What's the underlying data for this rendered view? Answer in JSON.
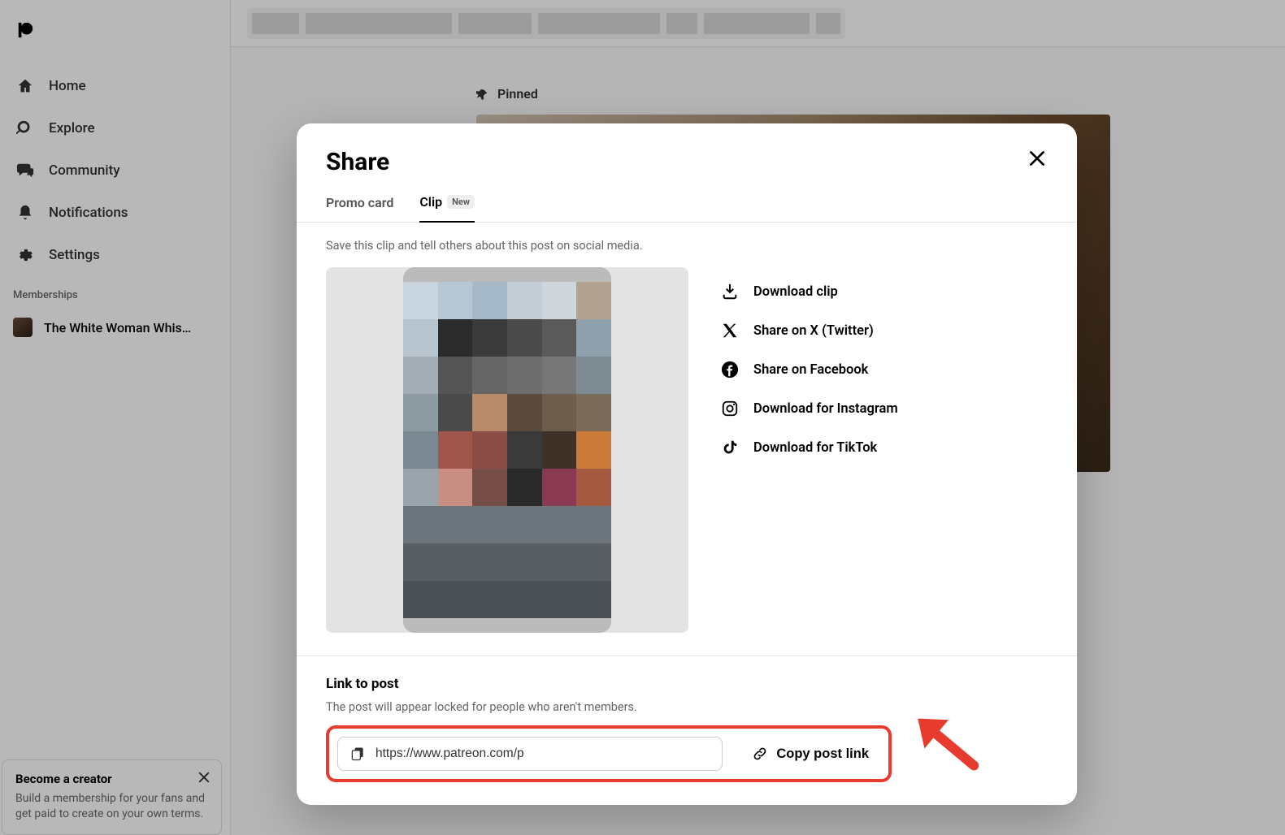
{
  "sidebar": {
    "items": [
      {
        "label": "Home",
        "icon": "home-icon"
      },
      {
        "label": "Explore",
        "icon": "search-icon"
      },
      {
        "label": "Community",
        "icon": "chat-icon"
      },
      {
        "label": "Notifications",
        "icon": "bell-icon"
      },
      {
        "label": "Settings",
        "icon": "gear-icon"
      }
    ],
    "memberships_label": "Memberships",
    "memberships": [
      {
        "label": "The White Woman Whis…"
      }
    ],
    "creator_card": {
      "title": "Become a creator",
      "desc": "Build a membership for your fans and get paid to create on your own terms."
    }
  },
  "content": {
    "pinned_label": "Pinned"
  },
  "modal": {
    "title": "Share",
    "tabs": [
      {
        "label": "Promo card"
      },
      {
        "label": "Clip",
        "badge": "New"
      }
    ],
    "active_tab": 1,
    "helper": "Save this clip and tell others about this post on social media.",
    "options": [
      {
        "label": "Download clip",
        "icon": "download-icon"
      },
      {
        "label": "Share on X (Twitter)",
        "icon": "x-icon"
      },
      {
        "label": "Share on Facebook",
        "icon": "facebook-icon"
      },
      {
        "label": "Download for Instagram",
        "icon": "instagram-icon"
      },
      {
        "label": "Download for TikTok",
        "icon": "tiktok-icon"
      }
    ],
    "link_section": {
      "title": "Link to post",
      "desc": "The post will appear locked for people who aren't members.",
      "url": "https://www.patreon.com/p",
      "copy_label": "Copy post link"
    }
  },
  "pixel_colors": [
    "#c9d6df",
    "#b6c8d6",
    "#a6b9c8",
    "#c2cdd5",
    "#d0d7dc",
    "#b2a18f",
    "#b8c5cf",
    "#2b2b2b",
    "#3a3a3a",
    "#4a4a4a",
    "#5a5a5a",
    "#8fa1ad",
    "#a3aeb6",
    "#555",
    "#666",
    "#6e6e6e",
    "#777",
    "#7f8b93",
    "#8e9aa2",
    "#4a4a4a",
    "#b88a6a",
    "#5a4a3d",
    "#6e5c4c",
    "#7a6a58",
    "#7c8891",
    "#a0564d",
    "#8a4c44",
    "#3a3a3a",
    "#3f3028",
    "#cc7a3a",
    "#9aa3aa",
    "#c98e82",
    "#774e47",
    "#2a2a2a",
    "#8a3a52",
    "#a55a40",
    "#6c757c",
    "#6c757c",
    "#6c757c",
    "#6c757c",
    "#6c757c",
    "#6c757c",
    "#575f65",
    "#575f65",
    "#575f65",
    "#575f65",
    "#575f65",
    "#575f65",
    "#4a5055",
    "#4a5055",
    "#4a5055",
    "#4a5055",
    "#4a5055",
    "#4a5055"
  ]
}
